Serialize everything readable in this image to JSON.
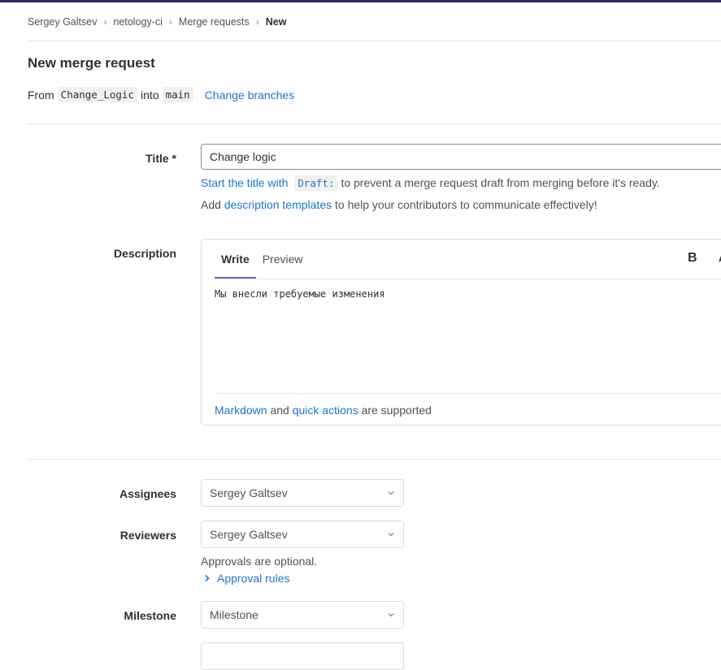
{
  "breadcrumb": {
    "items": [
      "Sergey Galtsev",
      "netology-ci",
      "Merge requests"
    ],
    "current": "New",
    "separator": "›"
  },
  "page": {
    "title": "New merge request"
  },
  "branches": {
    "from_label": "From",
    "source": "Change_Logic",
    "into_label": "into",
    "target": "main",
    "change_link": "Change branches"
  },
  "form": {
    "title_label": "Title *",
    "title_value": "Change logic",
    "draft_hint": {
      "prefix": "Start the title with",
      "code": "Draft:",
      "suffix": "to prevent a merge request draft from merging before it's ready."
    },
    "templates_hint": {
      "prefix": "Add",
      "link": "description templates",
      "suffix": "to help your contributors to communicate effectively!"
    },
    "description_label": "Description",
    "tabs": {
      "write": "Write",
      "preview": "Preview"
    },
    "toolbar": {
      "bold": "B",
      "more": "A"
    },
    "description_value": "Мы внесли требуемые изменения",
    "markdown_hint": {
      "markdown": "Markdown",
      "and": "and",
      "quick_actions": "quick actions",
      "suffix": "are supported"
    },
    "assignees_label": "Assignees",
    "assignees_value": "Sergey Galtsev",
    "reviewers_label": "Reviewers",
    "reviewers_value": "Sergey Galtsev",
    "approvals_text": "Approvals are optional.",
    "approval_rules_link": "Approval rules",
    "milestone_label": "Milestone",
    "milestone_value": "Milestone"
  },
  "colors": {
    "link": "#1f75cb",
    "accent": "#6666c4",
    "topbar": "#292961"
  },
  "icons": {
    "chevron": "chevron-down-icon",
    "approval_chevron": "chevron-right-icon"
  }
}
